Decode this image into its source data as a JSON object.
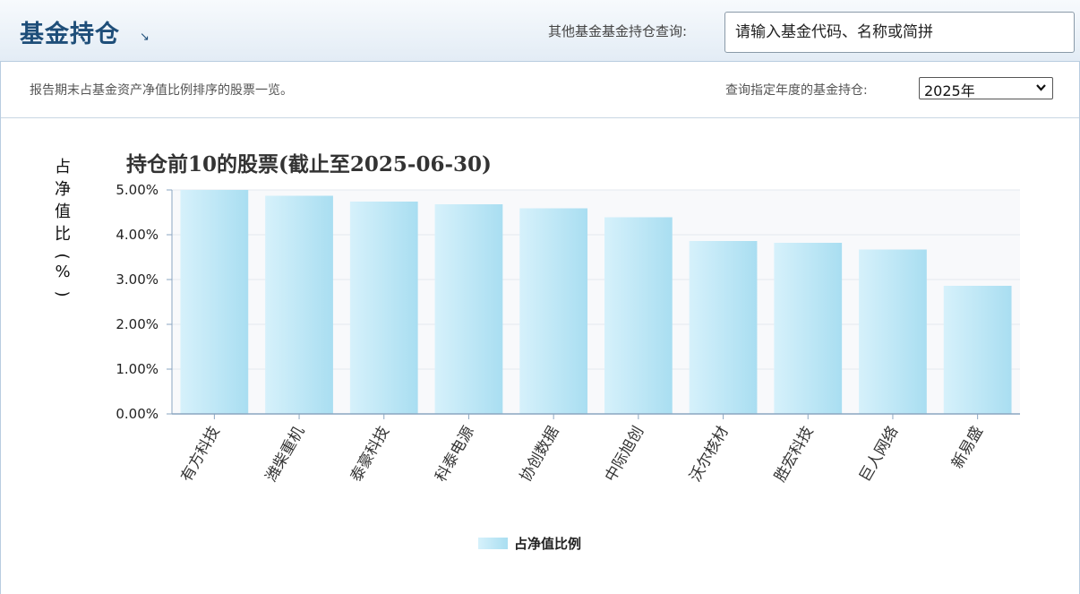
{
  "header": {
    "title": "基金持仓",
    "title_arrow": "↘",
    "query_label": "其他基金基金持仓查询:",
    "search_placeholder": "请输入基金代码、名称或简拼"
  },
  "toolbar": {
    "description": "报告期末占基金资产净值比例排序的股票一览。",
    "year_label": "查询指定年度的基金持仓:",
    "year_selected": "2025年"
  },
  "colors": {
    "accent": "#1e4e79",
    "bar_light": "#d6f1fb",
    "bar_dark": "#a9def1"
  },
  "chart_data": {
    "type": "bar",
    "title": "持仓前10的股票(截止至2025-06-30)",
    "ylabel": "占净值比(%)",
    "xlabel": "",
    "ylim": [
      0,
      5
    ],
    "yticks": [
      "0.00%",
      "1.00%",
      "2.00%",
      "3.00%",
      "4.00%",
      "5.00%"
    ],
    "grid": true,
    "legend_position": "bottom-center",
    "categories": [
      "有方科技",
      "潍柴重机",
      "泰豪科技",
      "科泰电源",
      "协创数据",
      "中际旭创",
      "沃尔核材",
      "胜宏科技",
      "巨人网络",
      "新易盛"
    ],
    "series": [
      {
        "name": "占净值比例",
        "values": [
          5.01,
          4.87,
          4.74,
          4.68,
          4.59,
          4.39,
          3.86,
          3.82,
          3.67,
          2.86
        ]
      }
    ]
  }
}
